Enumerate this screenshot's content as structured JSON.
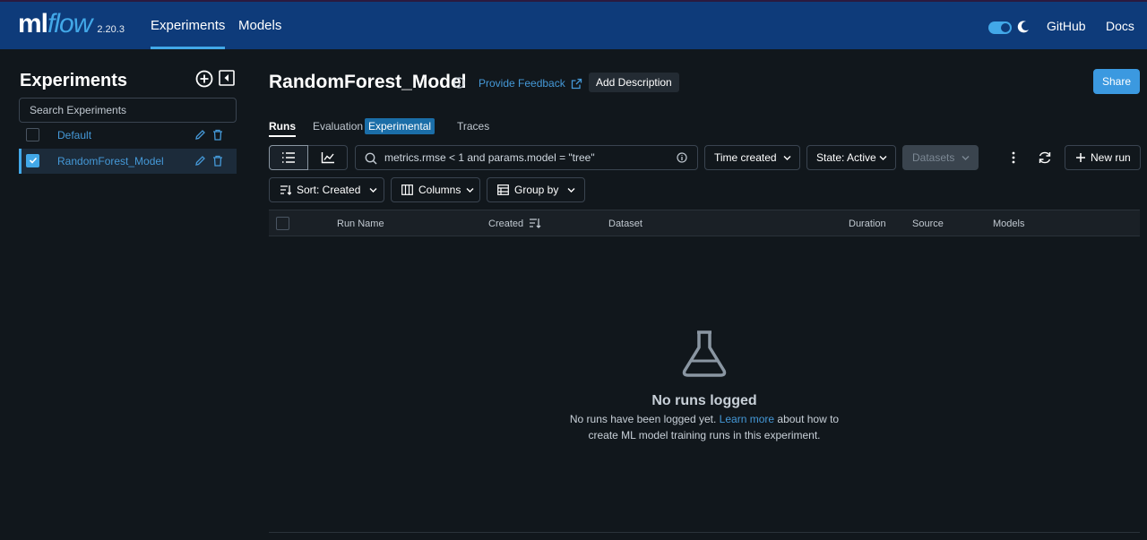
{
  "topbar": {
    "logo_ml": "ml",
    "logo_flow": "flow",
    "version": "2.20.3",
    "nav": {
      "experiments": "Experiments",
      "models": "Models",
      "github": "GitHub",
      "docs": "Docs"
    },
    "theme_toggle_on": true
  },
  "sidebar": {
    "title": "Experiments",
    "search_placeholder": "Search Experiments",
    "experiments": [
      {
        "name": "Default",
        "selected": false
      },
      {
        "name": "RandomForest_Model",
        "selected": true
      }
    ]
  },
  "main": {
    "title": "RandomForest_Model",
    "feedback_link": "Provide Feedback",
    "add_description": "Add Description",
    "share": "Share",
    "tabs": {
      "runs": "Runs",
      "evaluation": "Evaluation",
      "experimental_tag": "Experimental",
      "traces": "Traces"
    },
    "filter_value": "metrics.rmse < 1 and params.model = \"tree\"",
    "time_created": "Time created",
    "state": "State: Active",
    "datasets": "Datasets",
    "new_run": "New run",
    "sort": "Sort: Created",
    "columns": "Columns",
    "group_by": "Group by",
    "table_headers": {
      "run_name": "Run Name",
      "created": "Created",
      "dataset": "Dataset",
      "duration": "Duration",
      "source": "Source",
      "models": "Models"
    },
    "empty": {
      "title": "No runs logged",
      "line1_prefix": "No runs have been logged yet.",
      "learn_more": "Learn more",
      "line1_suffix": "about how to",
      "line2": "create ML model training runs in this experiment."
    }
  },
  "colors": {
    "topbar": "#0e3b7a",
    "accent": "#42a8e8",
    "link": "#4599d8",
    "background": "#11171c"
  }
}
